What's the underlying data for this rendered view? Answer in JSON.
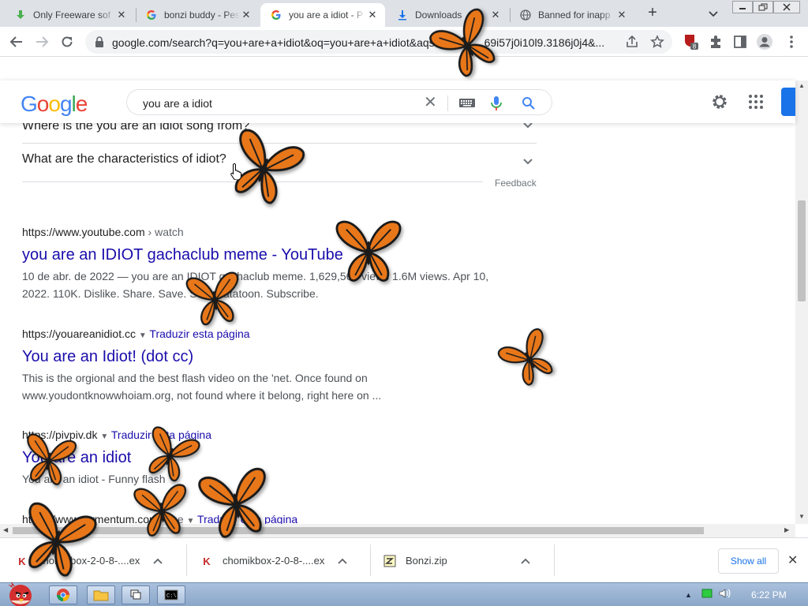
{
  "browser": {
    "tabs": [
      {
        "title": "Only Freeware sof",
        "favicon": "download-arrow-icon"
      },
      {
        "title": "bonzi buddy - Pes",
        "favicon": "google-icon"
      },
      {
        "title": "you are a idiot - P",
        "favicon": "google-icon",
        "active": true
      },
      {
        "title": "Downloads",
        "favicon": "download-icon"
      },
      {
        "title": "Banned for inapp",
        "favicon": "globe-icon"
      }
    ],
    "url": "google.com/search?q=you+are+a+idiot&oq=you+are+a+idiot&aqs=ch",
    "url_tail": "69i57j0i10l9.3186j0j4&...",
    "extension_badge": "8"
  },
  "google": {
    "logo": "Google",
    "query": "you are a idiot"
  },
  "faq": [
    {
      "question": "Where is the you are an idiot song from?"
    },
    {
      "question": "What are the characteristics of idiot?"
    }
  ],
  "feedback_label": "Feedback",
  "results": [
    {
      "cite": "https://www.youtube.com",
      "cite_path": " › watch",
      "translate": "",
      "title": "you are an IDIOT gachaclub meme - YouTube",
      "snippet_line1": "10 de abr. de 2022 — you are an IDIOT gachaclub meme. 1,629,563 views 1.6M views. Apr 10,",
      "snippet_line2": "2022. 110K. Dislike. Share. Save. Sonicuatatoon. Subscribe."
    },
    {
      "cite": "https://youareanidiot.cc",
      "cite_path": "",
      "translate": "Traduzir esta página",
      "title": "You are an Idiot! (dot cc)",
      "snippet_line1": "This is the orgional and the best flash video on the 'net. Once found on",
      "snippet_line2": "www.youdontknowwhoiam.org, not found where it belong, right here on ..."
    },
    {
      "cite": "https://pivpiv.dk",
      "cite_path": "",
      "translate": "Traduzir esta página",
      "title": "You are an idiot",
      "snippet_line1": "You are an idiot - Funny flash",
      "snippet_line2": ""
    },
    {
      "cite": "https://www.tormentum.com",
      "cite_path": " › me",
      "translate": "Traduzir esta página",
      "title": "",
      "snippet_line1": "",
      "snippet_line2": ""
    }
  ],
  "downloads": [
    {
      "name": "chomikbox-2-0-8-....exe",
      "icon": "chomikbox-icon"
    },
    {
      "name": "chomikbox-2-0-8-....exe",
      "icon": "chomikbox-icon"
    },
    {
      "name": "Bonzi.zip",
      "icon": "zip-file-icon"
    }
  ],
  "show_all_label": "Show all",
  "taskbar": {
    "clock": "6:22 PM"
  },
  "colors": {
    "link": "#1a0dab",
    "accent": "#1a73e8",
    "butterfly": "#e8771a"
  }
}
